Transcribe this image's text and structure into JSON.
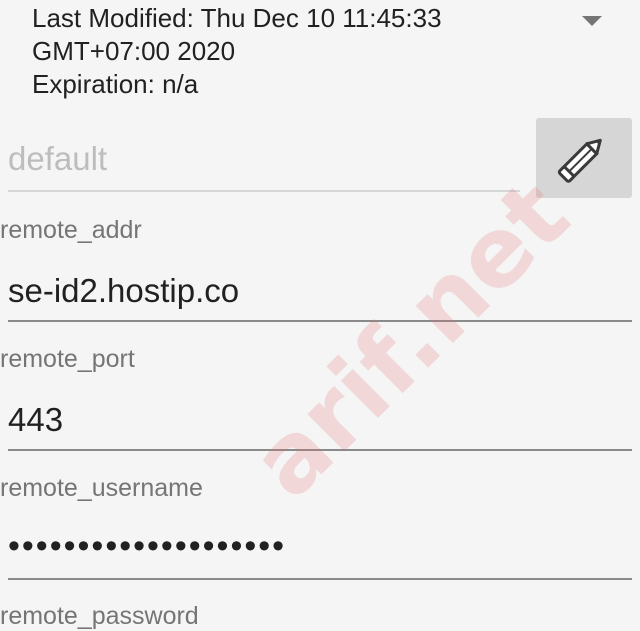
{
  "profile_info": {
    "last_modified_line1": "Last Modified: Thu Dec 10 11:45:33",
    "last_modified_line2": "GMT+07:00 2020",
    "expiration": "Expiration: n/a"
  },
  "profile_name": {
    "placeholder": "default",
    "value": ""
  },
  "fields": {
    "remote_addr": {
      "label": "remote_addr",
      "value": "se-id2.hostip.co"
    },
    "remote_port": {
      "label": "remote_port",
      "value": "443"
    },
    "remote_username": {
      "label": "remote_username",
      "value": "••••••••••••••••••••"
    },
    "remote_password": {
      "label": "remote_password"
    }
  },
  "watermark": {
    "text": "arif.net"
  },
  "icons": {
    "dropdown": "chevron-down-icon",
    "edit": "pencil-icon"
  }
}
